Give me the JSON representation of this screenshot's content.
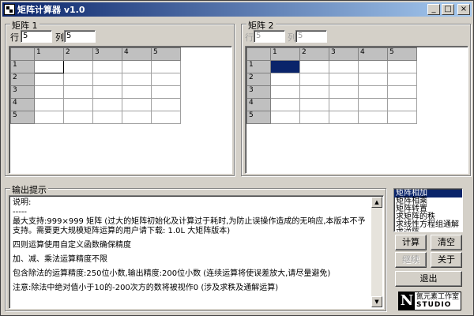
{
  "window": {
    "title": "矩阵计算器  v1.0",
    "buttons": {
      "minimize": "_",
      "maximize": "□",
      "close": "×"
    }
  },
  "matrix1": {
    "legend": "矩阵 1",
    "row_label": "行",
    "col_label": "列",
    "rows_value": "5",
    "cols_value": "5",
    "col_headers": [
      "1",
      "2",
      "3",
      "4",
      "5"
    ],
    "row_headers": [
      "1",
      "2",
      "3",
      "4",
      "5"
    ]
  },
  "matrix2": {
    "legend": "矩阵 2",
    "row_label": "行",
    "col_label": "列",
    "rows_value": "5",
    "cols_value": "5",
    "col_headers": [
      "1",
      "2",
      "3",
      "4",
      "5"
    ],
    "row_headers": [
      "1",
      "2",
      "3",
      "4",
      "5"
    ]
  },
  "output": {
    "legend": "输出提示",
    "lines": [
      "说明:",
      "-----",
      "最大支持:999×999 矩阵 (过大的矩阵初始化及计算过于耗时,为防止误操作造成的无响应,本版本不予支持。需要更大规模矩阵运算的用户请下载: 1.0L 大矩阵版本)",
      "四则运算使用自定义函数确保精度",
      "加、减、乘法运算精度不限",
      "包含除法的运算精度:250位小数,输出精度:200位小数 (连续运算将使误差放大,请尽量避免)",
      "注意:除法中绝对值小于10的-200次方的数将被视作0 (涉及求秩及通解运算)"
    ]
  },
  "operations": {
    "items": [
      "矩阵相加",
      "矩阵相乘",
      "矩阵转置",
      "求矩阵的秩",
      "求线性方程组通解",
      "求逆阵"
    ],
    "selected_index": 0
  },
  "buttons": {
    "calculate": "计算",
    "clear": "清空",
    "continue": "继续",
    "about": "关于",
    "exit": "退出"
  },
  "logo": {
    "letter": "N",
    "chinese": "氮元素工作室",
    "english": "STUDIO"
  }
}
